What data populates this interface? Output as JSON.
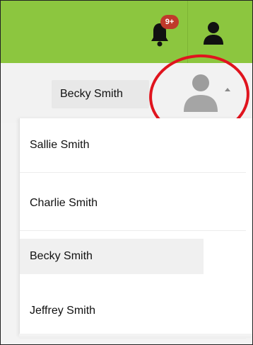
{
  "header": {
    "notification_badge": "9+",
    "icons": {
      "bell": "bell-icon",
      "user": "user-icon"
    },
    "colors": {
      "bar": "#8cc63f",
      "badge": "#c0392b"
    }
  },
  "user_switcher": {
    "selected_name": "Becky Smith",
    "avatar": "avatar-icon",
    "caret": "caret-up-icon",
    "highlight_color": "#e0141e"
  },
  "dropdown": {
    "items": [
      {
        "label": "Sallie Smith"
      },
      {
        "label": "Charlie Smith"
      },
      {
        "label": "Becky Smith"
      },
      {
        "label": "Jeffrey Smith"
      }
    ]
  }
}
